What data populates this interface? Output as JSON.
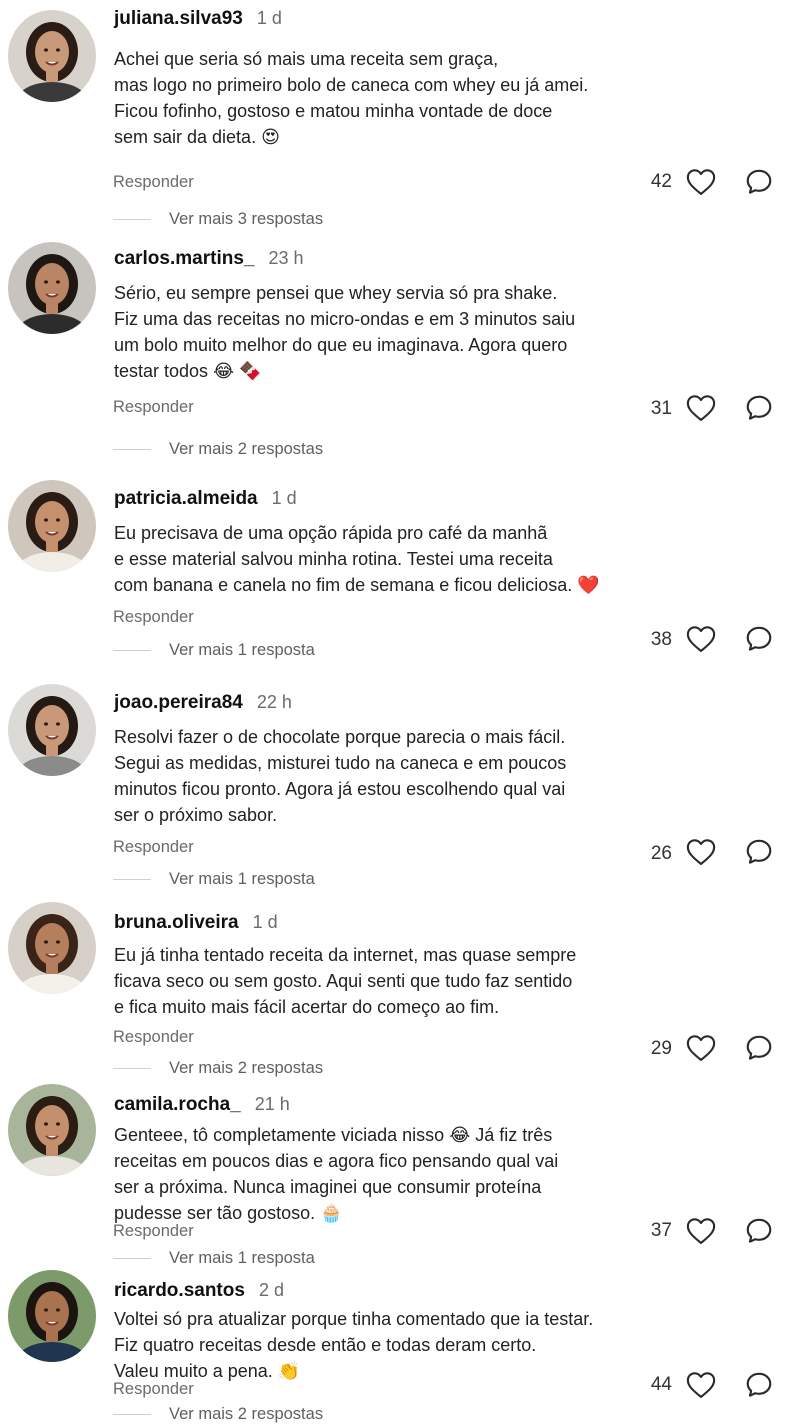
{
  "comments": [
    {
      "username": "juliana.silva93",
      "time": "1 d",
      "lines": [
        "Achei que seria só mais uma receita sem graça,",
        "mas logo no primeiro bolo de caneca com whey eu já amei.",
        "Ficou fofinho, gostoso e matou minha vontade de doce",
        "sem sair da dieta. 😍"
      ],
      "reply_label": "Responder",
      "likes": "42",
      "more_replies": "Ver mais 3 respostas",
      "avatar": {
        "skin": "#c99a7a",
        "hair": "#2b1d16",
        "shirt": "#3a3a3a",
        "bg": "#d8d2cc"
      }
    },
    {
      "username": "carlos.martins_",
      "time": "23 h",
      "lines": [
        "Sério, eu sempre pensei que whey servia só pra shake.",
        "Fiz uma das receitas no micro-ondas e em 3 minutos saiu",
        "um bolo muito melhor do que eu imaginava. Agora quero",
        "testar todos 😂 🍫"
      ],
      "reply_label": "Responder",
      "likes": "31",
      "more_replies": "Ver mais 2 respostas",
      "avatar": {
        "skin": "#b98565",
        "hair": "#1f1712",
        "shirt": "#2c2c2c",
        "bg": "#c7c4c0"
      }
    },
    {
      "username": "patricia.almeida",
      "time": "1 d",
      "lines": [
        "Eu precisava de uma opção rápida pro café da manhã",
        "e esse material salvou minha rotina. Testei uma receita",
        "com banana e canela no fim de semana e ficou deliciosa. ❤️"
      ],
      "reply_label": "Responder",
      "likes": "38",
      "more_replies": "Ver mais 1 resposta",
      "avatar": {
        "skin": "#c4906d",
        "hair": "#2a1c15",
        "shirt": "#f2ede6",
        "bg": "#cfc7bd"
      }
    },
    {
      "username": "joao.pereira84",
      "time": "22 h",
      "lines": [
        "Resolvi fazer o de chocolate porque parecia o mais fácil.",
        "Segui as medidas, misturei tudo na caneca e em poucos",
        "minutos ficou pronto. Agora já estou escolhendo qual vai",
        "ser o próximo sabor."
      ],
      "reply_label": "Responder",
      "likes": "26",
      "more_replies": "Ver mais 1 resposta",
      "avatar": {
        "skin": "#c99878",
        "hair": "#241913",
        "shirt": "#8a8a88",
        "bg": "#dcdad6"
      }
    },
    {
      "username": "bruna.oliveira",
      "time": "1 d",
      "lines": [
        "Eu já tinha tentado receita da internet, mas quase sempre",
        "ficava seco ou sem gosto. Aqui senti que tudo faz sentido",
        "e fica muito mais fácil acertar do começo ao fim."
      ],
      "reply_label": "Responder",
      "likes": "29",
      "more_replies": "Ver mais 2 respostas",
      "avatar": {
        "skin": "#b57e5c",
        "hair": "#3a2418",
        "shirt": "#f4f0ea",
        "bg": "#d6d0c8"
      }
    },
    {
      "username": "camila.rocha_",
      "time": "21 h",
      "lines": [
        "Genteee, tô completamente viciada nisso 😂  Já fiz três",
        "receitas em poucos dias e agora fico pensando qual vai",
        "ser a próxima. Nunca imaginei que consumir proteína",
        "pudesse ser tão gostoso. 🧁"
      ],
      "reply_label": "Responder",
      "likes": "37",
      "more_replies": "Ver mais 1 resposta",
      "avatar": {
        "skin": "#c48f6c",
        "hair": "#2b1c14",
        "shirt": "#e8e4de",
        "bg": "#a9b59a"
      }
    },
    {
      "username": "ricardo.santos",
      "time": "2 d",
      "lines": [
        "Voltei só pra atualizar porque tinha comentado que ia testar.",
        "Fiz quatro receitas desde então e todas deram certo.",
        "Valeu muito a pena. 👏"
      ],
      "reply_label": "Responder",
      "likes": "44",
      "more_replies": "Ver mais 2 respostas",
      "avatar": {
        "skin": "#a9734f",
        "hair": "#1c1410",
        "shirt": "#1f3550",
        "bg": "#7d9a6a"
      }
    }
  ]
}
